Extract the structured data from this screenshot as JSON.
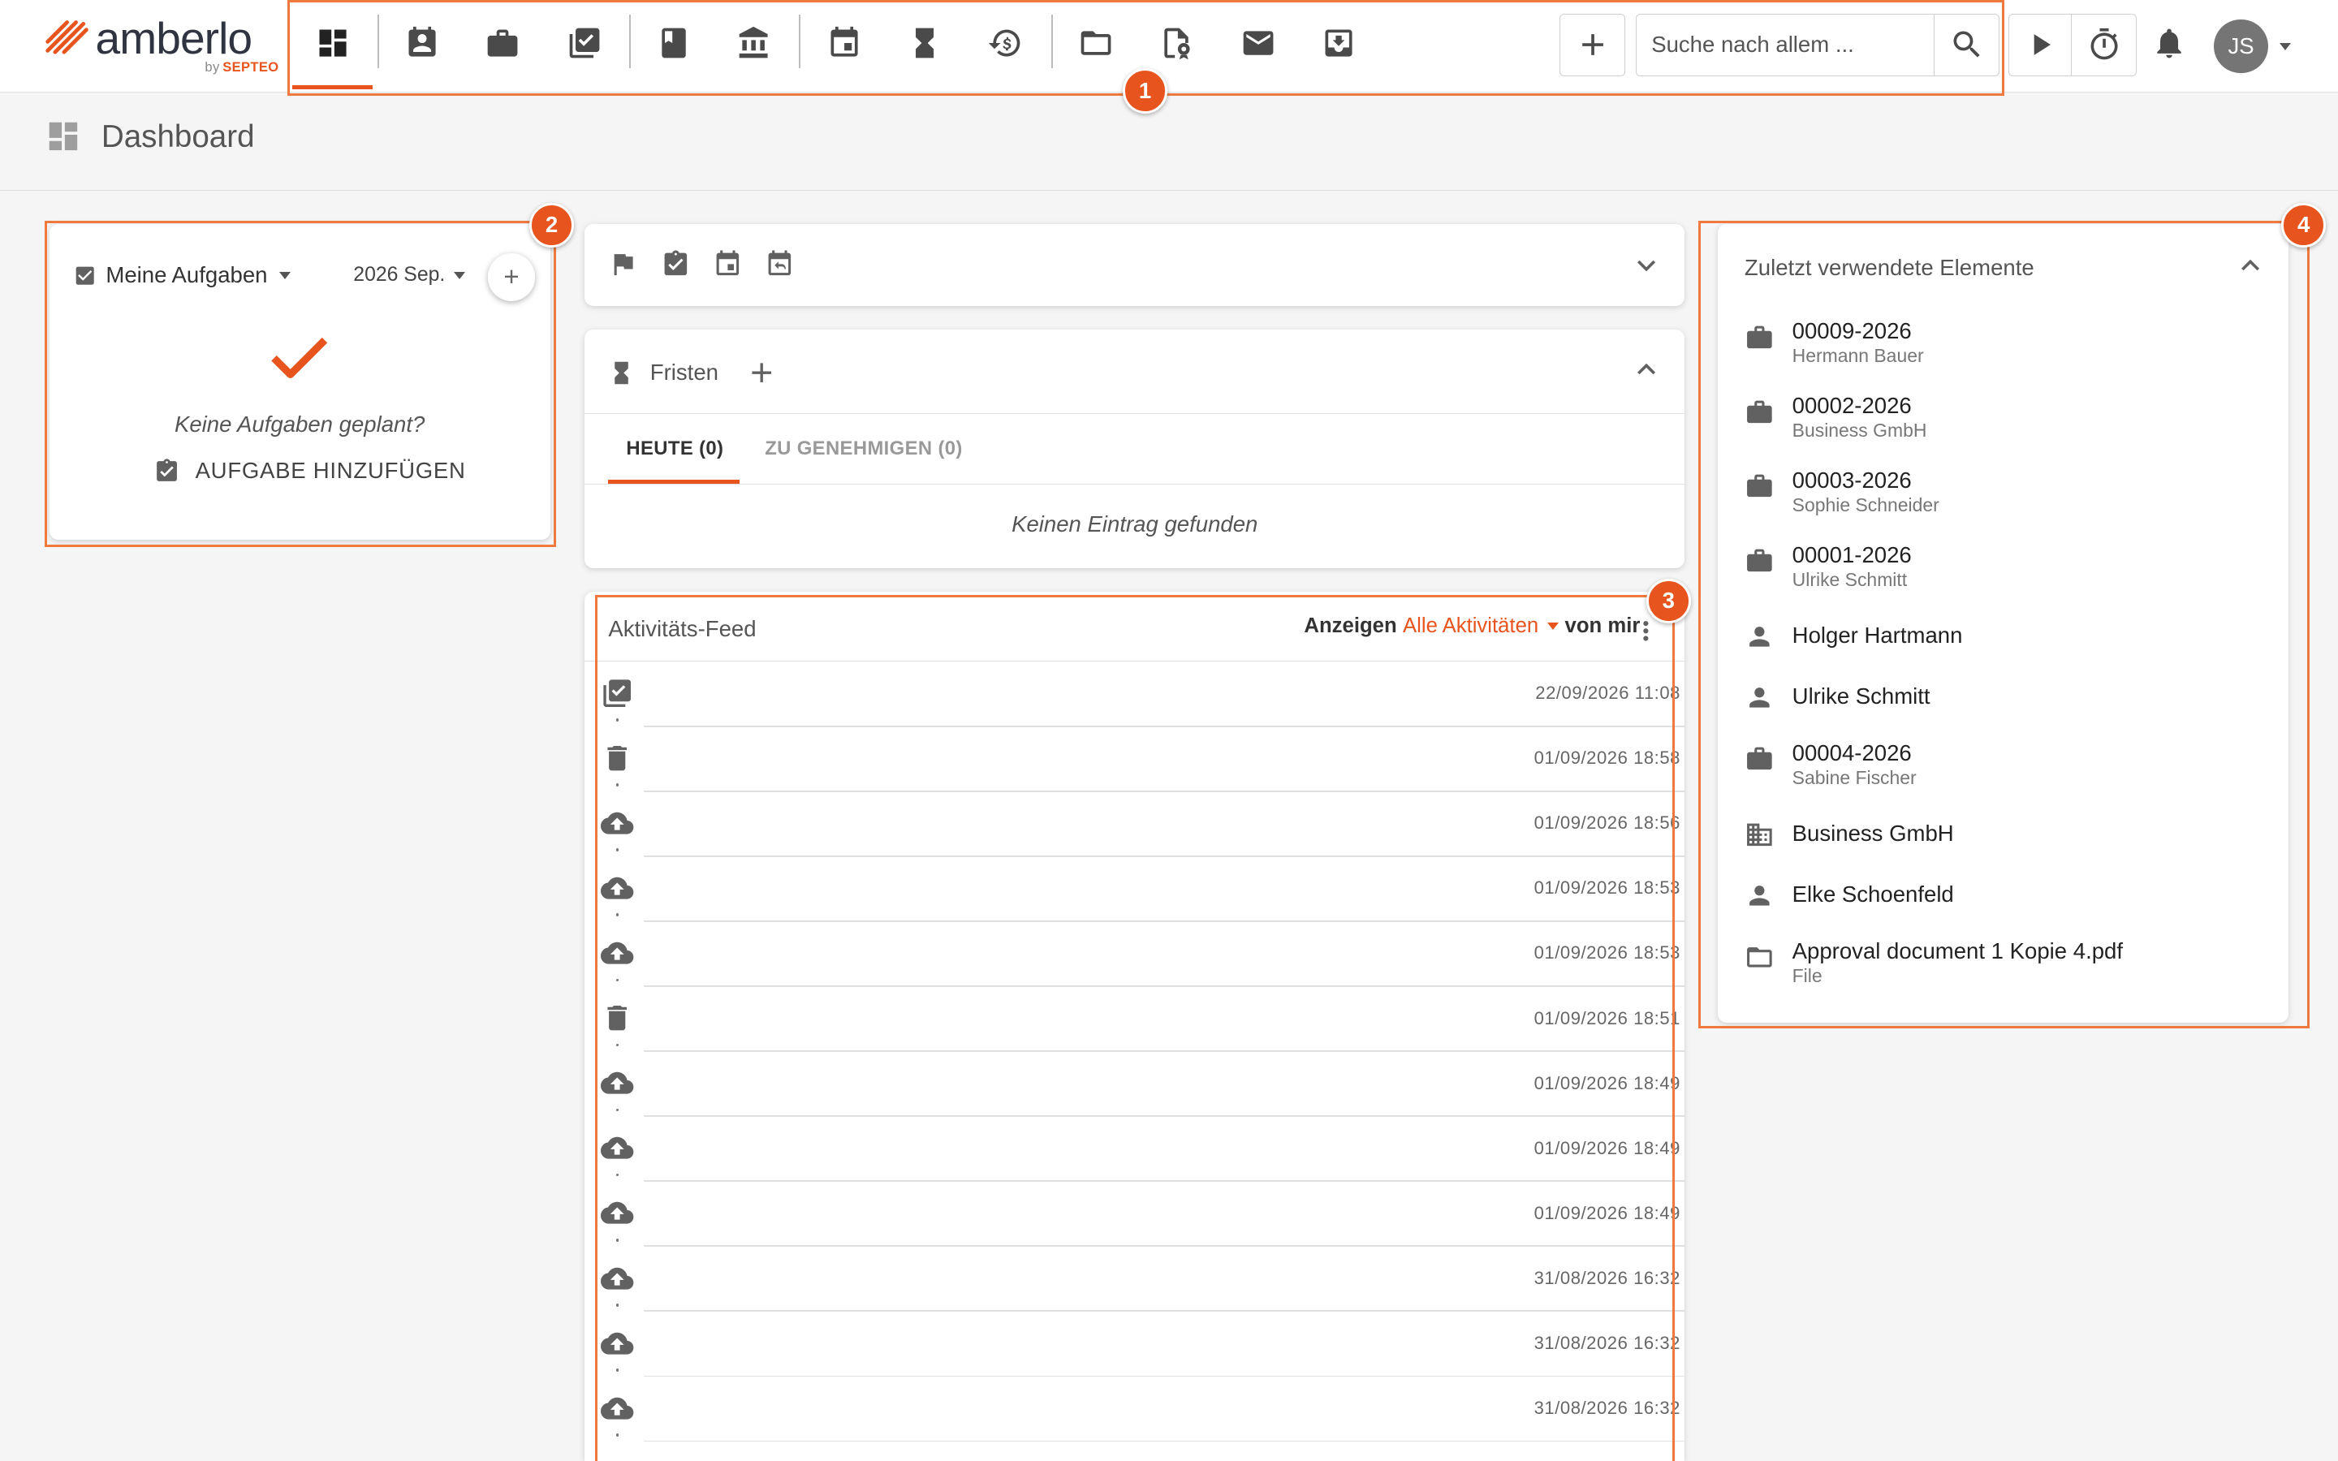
{
  "app": {
    "logo_text": "amberlo",
    "logo_by": "by",
    "logo_brand": "SEPTEO",
    "accent": "#e8541e"
  },
  "nav": [
    {
      "icon": "dashboard-icon",
      "active": true
    },
    {
      "icon": "contacts-icon"
    },
    {
      "icon": "matters-briefcase-icon"
    },
    {
      "icon": "tasks-icon"
    },
    {
      "icon": "book-icon"
    },
    {
      "icon": "bank-icon"
    },
    {
      "icon": "calendar-icon"
    },
    {
      "icon": "deadline-hourglass-icon"
    },
    {
      "icon": "time-billing-icon"
    },
    {
      "icon": "folder-icon"
    },
    {
      "icon": "document-stamp-icon"
    },
    {
      "icon": "mail-icon"
    },
    {
      "icon": "inbox-download-icon"
    }
  ],
  "search": {
    "placeholder": "Suche nach allem ..."
  },
  "user": {
    "initials": "JS"
  },
  "page": {
    "title": "Dashboard"
  },
  "badges": [
    "1",
    "2",
    "3",
    "4"
  ],
  "tasks": {
    "title": "Meine Aufgaben",
    "month": "2026 Sep.",
    "add_label": "+",
    "empty_text": "Keine Aufgaben geplant?",
    "add_task_label": "AUFGABE HINZUFÜGEN"
  },
  "quick_icons": [
    "flag-icon",
    "task-check-icon",
    "calendar-event-icon",
    "calendar-reply-icon"
  ],
  "deadlines": {
    "title": "Fristen",
    "tabs": [
      {
        "label": "HEUTE (0)",
        "active": true
      },
      {
        "label": "ZU GENEHMIGEN (0)",
        "active": false
      }
    ],
    "empty_text": "Keinen Eintrag gefunden"
  },
  "activity": {
    "title": "Aktivitäts-Feed",
    "show_label": "Anzeigen",
    "filter_value": "Alle Aktivitäten",
    "by_label": "von mir",
    "items": [
      {
        "icon": "task-done-icon",
        "time": "22/09/2026 11:08"
      },
      {
        "icon": "trash-icon",
        "time": "01/09/2026 18:58"
      },
      {
        "icon": "cloud-upload-icon",
        "time": "01/09/2026 18:56"
      },
      {
        "icon": "cloud-upload-icon",
        "time": "01/09/2026 18:53"
      },
      {
        "icon": "cloud-upload-icon",
        "time": "01/09/2026 18:53"
      },
      {
        "icon": "trash-icon",
        "time": "01/09/2026 18:51"
      },
      {
        "icon": "cloud-upload-icon",
        "time": "01/09/2026 18:49"
      },
      {
        "icon": "cloud-upload-icon",
        "time": "01/09/2026 18:49"
      },
      {
        "icon": "cloud-upload-icon",
        "time": "01/09/2026 18:49"
      },
      {
        "icon": "cloud-upload-icon",
        "time": "31/08/2026 16:32"
      },
      {
        "icon": "cloud-upload-icon",
        "time": "31/08/2026 16:32"
      },
      {
        "icon": "cloud-upload-icon",
        "time": "31/08/2026 16:32"
      }
    ]
  },
  "recent": {
    "title": "Zuletzt verwendete Elemente",
    "items": [
      {
        "icon": "briefcase-icon",
        "title": "00009-2026",
        "subtitle": "Hermann Bauer"
      },
      {
        "icon": "briefcase-icon",
        "title": "00002-2026",
        "subtitle": "Business GmbH"
      },
      {
        "icon": "briefcase-icon",
        "title": "00003-2026",
        "subtitle": "Sophie Schneider"
      },
      {
        "icon": "briefcase-icon",
        "title": "00001-2026",
        "subtitle": "Ulrike Schmitt"
      },
      {
        "icon": "person-icon",
        "title": "Holger Hartmann",
        "subtitle": ""
      },
      {
        "icon": "person-icon",
        "title": "Ulrike Schmitt",
        "subtitle": ""
      },
      {
        "icon": "briefcase-icon",
        "title": "00004-2026",
        "subtitle": "Sabine Fischer"
      },
      {
        "icon": "building-icon",
        "title": "Business GmbH",
        "subtitle": ""
      },
      {
        "icon": "person-icon",
        "title": "Elke Schoenfeld",
        "subtitle": ""
      },
      {
        "icon": "folder-outline-icon",
        "title": "Approval document 1 Kopie 4.pdf",
        "subtitle": "File"
      }
    ]
  }
}
